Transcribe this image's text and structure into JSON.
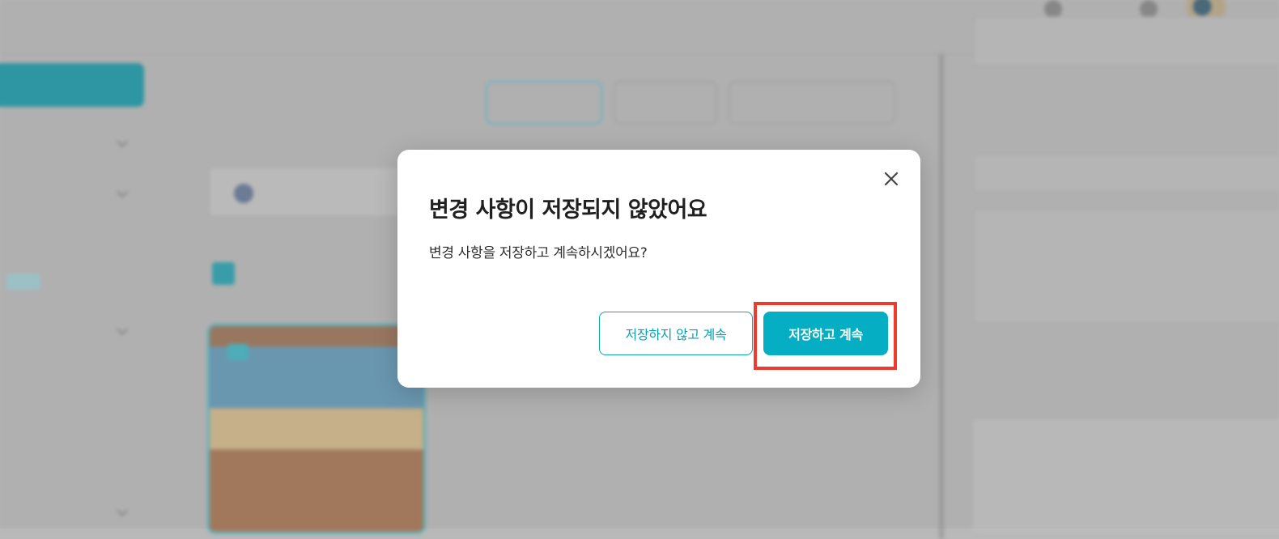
{
  "modal": {
    "title": "변경 사항이 저장되지 않았어요",
    "message": "변경 사항을 저장하고 계속하시겠어요?",
    "close_icon": "close-icon",
    "buttons": {
      "discard_label": "저장하지 않고 계속",
      "save_label": "저장하고 계속"
    }
  },
  "colors": {
    "accent": "#05aec3",
    "highlight": "#ee3b2e"
  }
}
